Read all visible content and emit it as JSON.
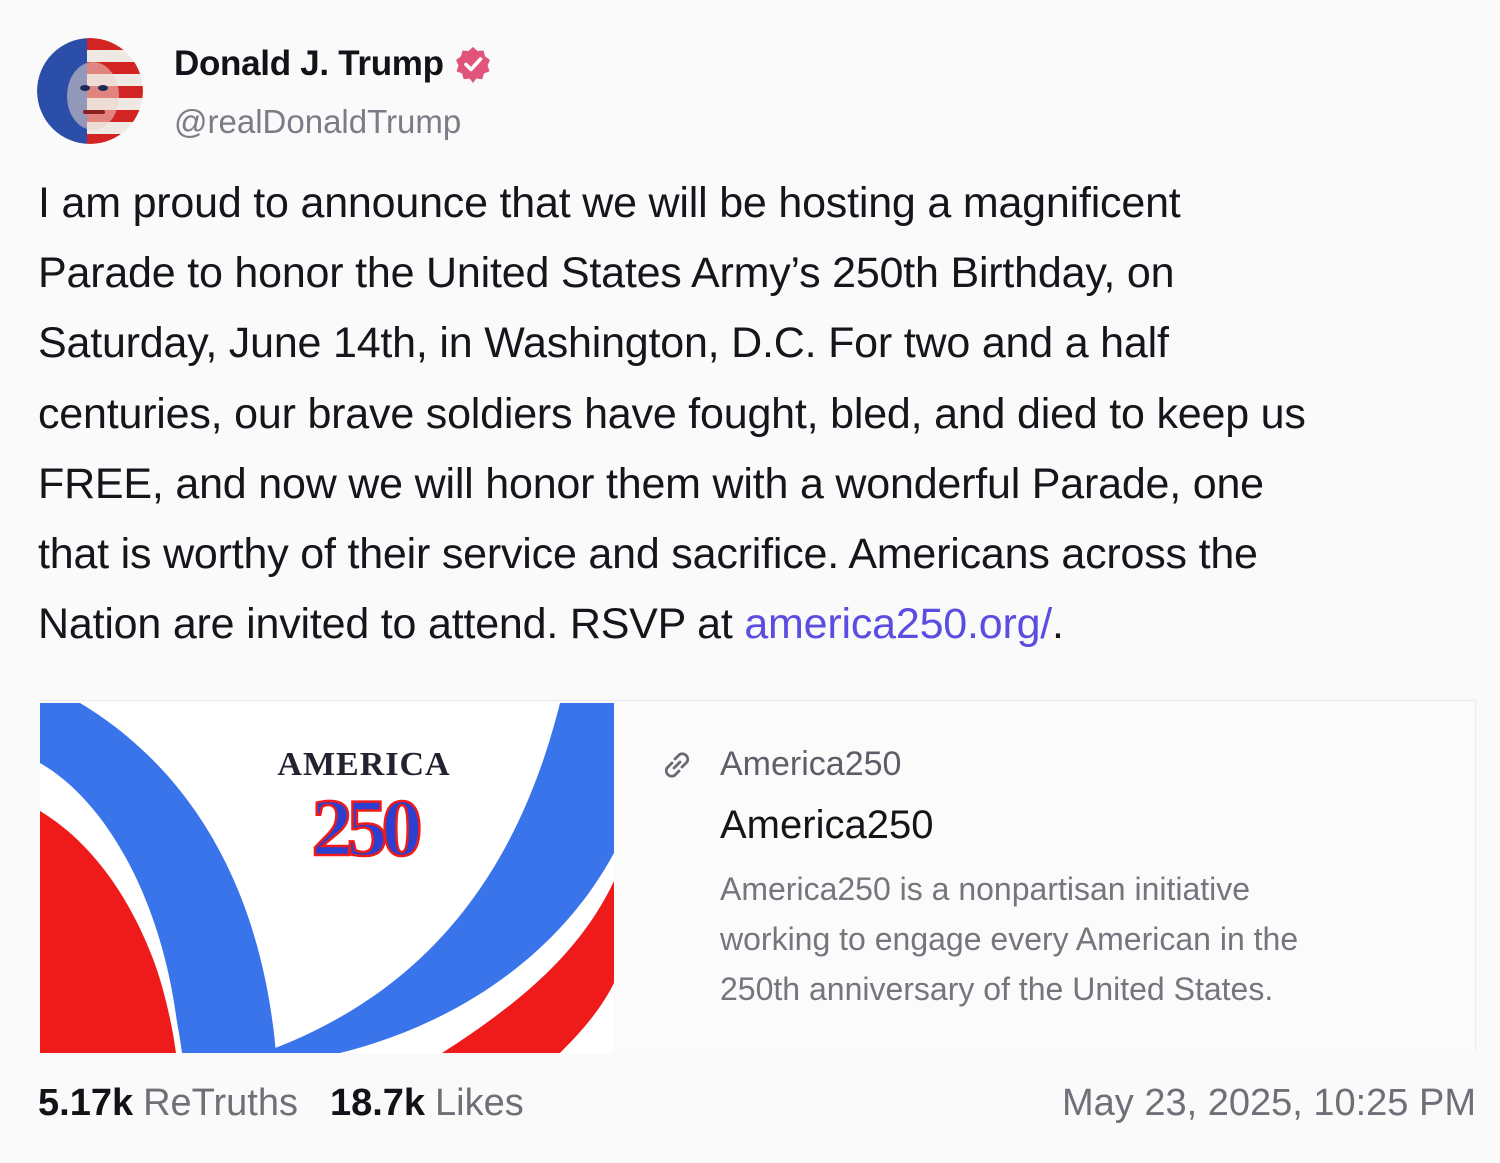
{
  "author": {
    "display_name": "Donald J. Trump",
    "handle": "@realDonaldTrump",
    "verified_color": "#e0537a"
  },
  "post": {
    "text_lines": [
      "I am proud to announce that we will be hosting a magnificent",
      "Parade to honor the United States Army’s 250th Birthday, on",
      "Saturday, June 14th, in Washington, D.C. For two and a half",
      "centuries, our brave soldiers have fought, bled, and died to keep us",
      "FREE, and now we will honor them with a wonderful Parade, one",
      "that is worthy of their service and sacrifice. Americans across the"
    ],
    "last_line_prefix": "Nation are invited to attend. RSVP at ",
    "link_text": "america250.org/",
    "last_line_suffix": ".",
    "link_color": "#5b4de0"
  },
  "card": {
    "logo_word": "AMERICA",
    "logo_number": "250",
    "source": "America250",
    "title": "America250",
    "description_lines": [
      "America250 is a nonpartisan initiative",
      "working to engage every American in the",
      "250th anniversary of the United States."
    ],
    "colors": {
      "blue": "#3a74ea",
      "red": "#ef1b1b"
    }
  },
  "stats": {
    "retruths_count": "5.17k",
    "retruths_label": "ReTruths",
    "likes_count": "18.7k",
    "likes_label": "Likes"
  },
  "timestamp": "May 23, 2025, 10:25 PM",
  "icons": {
    "avatar": "avatar-flag-portrait",
    "verified": "verified-badge-icon",
    "link": "link-icon"
  }
}
